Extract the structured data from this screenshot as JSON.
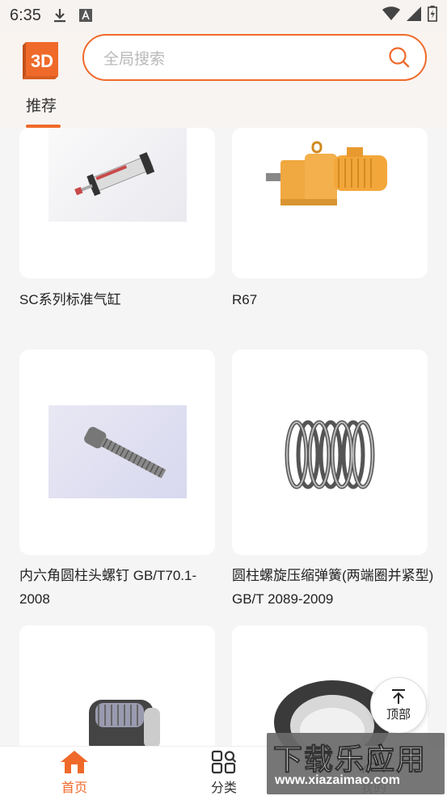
{
  "status_bar": {
    "time": "6:35",
    "download_icon": "download-icon",
    "a_icon": "a-icon"
  },
  "header": {
    "logo_text": "3D",
    "search_placeholder": "全局搜索",
    "tab_label": "推荐"
  },
  "products": [
    {
      "caption": "SC系列标准气缸",
      "image": "pneumatic-cylinder"
    },
    {
      "caption": "R67",
      "image": "gear-motor"
    },
    {
      "caption": "内六角圆柱头螺钉 GB/T70.1-2008",
      "image": "hex-socket-screw"
    },
    {
      "caption": "圆柱螺旋压缩弹簧(两端圈并紧型) GB/T 2089-2009",
      "image": "compression-spring"
    },
    {
      "caption": "",
      "image": "knurled-part"
    },
    {
      "caption": "",
      "image": "ring-part"
    }
  ],
  "top_button": {
    "label": "顶部"
  },
  "bottom_nav": {
    "home_label": "首页",
    "category_label": "分类",
    "mine_label": "我的"
  },
  "watermark": {
    "main": "下载乐应用",
    "sub": "www.xiazaimao.com"
  },
  "colors": {
    "accent": "#ef6a2a",
    "background": "#f5f5f5"
  }
}
